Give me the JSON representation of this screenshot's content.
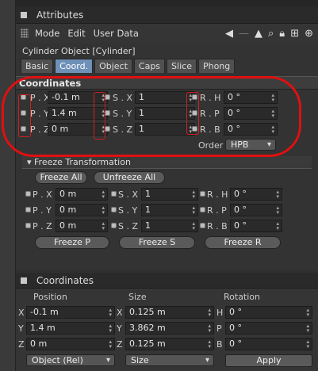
{
  "attributes": {
    "title": "Attributes",
    "menu": [
      "Mode",
      "Edit",
      "User Data"
    ],
    "object_label": "Cylinder Object [Cylinder]",
    "tabs": [
      "Basic",
      "Coord.",
      "Object",
      "Caps",
      "Slice",
      "Phong"
    ],
    "active_tab": "Coord.",
    "coordinates_header": "Coordinates",
    "position": {
      "x_label": "P . X",
      "x_value": "-0.1 m",
      "y_label": "P . Y",
      "y_value": "1.4 m",
      "z_label": "P . Z",
      "z_value": "0 m"
    },
    "scale": {
      "x_label": "S . X",
      "x_value": "1",
      "y_label": "S . Y",
      "y_value": "1",
      "z_label": "S . Z",
      "z_value": "1"
    },
    "rotation": {
      "h_label": "R . H",
      "h_value": "0 °",
      "p_label": "R . P",
      "p_value": "0 °",
      "b_label": "R . B",
      "b_value": "0 °"
    },
    "order_label": "Order",
    "order_value": "HPB",
    "freeze": {
      "header": "Freeze Transformation",
      "freeze_all": "Freeze All",
      "unfreeze_all": "Unfreeze All",
      "px_label": "P . X",
      "px_value": "0 m",
      "py_label": "P . Y",
      "py_value": "0 m",
      "pz_label": "P . Z",
      "pz_value": "0 m",
      "sx_label": "S . X",
      "sx_value": "1",
      "sy_label": "S . Y",
      "sy_value": "1",
      "sz_label": "S . Z",
      "sz_value": "1",
      "rh_label": "R . H",
      "rh_value": "0 °",
      "rp_label": "R . P",
      "rp_value": "0 °",
      "rb_label": "R . B",
      "rb_value": "0 °",
      "freeze_p": "Freeze P",
      "freeze_s": "Freeze S",
      "freeze_r": "Freeze R"
    }
  },
  "coordinates_manager": {
    "title": "Coordinates",
    "col_position": "Position",
    "col_size": "Size",
    "col_rotation": "Rotation",
    "pos_x_label": "X",
    "pos_x_value": "-0.1 m",
    "pos_y_label": "Y",
    "pos_y_value": "1.4 m",
    "pos_z_label": "Z",
    "pos_z_value": "0 m",
    "size_x_label": "X",
    "size_x_value": "0.125 m",
    "size_y_label": "Y",
    "size_y_value": "3.862 m",
    "size_z_label": "Z",
    "size_z_value": "0.125 m",
    "rot_h_label": "H",
    "rot_h_value": "0 °",
    "rot_p_label": "P",
    "rot_p_value": "0 °",
    "rot_b_label": "B",
    "rot_b_value": "0 °",
    "mode_dropdown": "Object (Rel)",
    "size_dropdown": "Size",
    "apply": "Apply"
  },
  "colors": {
    "accent_tab": "#6f91b8",
    "annotation_red": "#e01010"
  }
}
